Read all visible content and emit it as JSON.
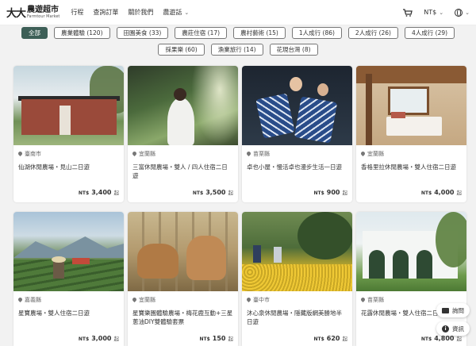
{
  "header": {
    "logo_zh": "農遊超市",
    "logo_en": "Farmtour Market",
    "nav": [
      {
        "label": "行程"
      },
      {
        "label": "查詢訂單"
      },
      {
        "label": "關於我們"
      },
      {
        "label": "農遊話"
      }
    ],
    "currency": "NT$"
  },
  "filters": {
    "row1": [
      "全部",
      "農業體驗 (120)",
      "田園美食 (33)",
      "農莊住宿 (17)",
      "農村藝術 (15)",
      "1人成行 (86)",
      "2人成行 (26)",
      "4人成行 (29)"
    ],
    "row2": [
      "採果樂 (60)",
      "漁業旅行 (14)",
      "花現台灣 (8)"
    ],
    "active": "全部"
  },
  "cards": [
    {
      "location": "臺南市",
      "title": "仙湖休閒農場・見山二日遊",
      "currency": "NT$",
      "price": "3,400",
      "suffix": "起"
    },
    {
      "location": "宜蘭縣",
      "title": "三富休閒農場・雙人 / 四人住宿二日遊",
      "currency": "NT$",
      "price": "3,500",
      "suffix": "起"
    },
    {
      "location": "苗栗縣",
      "title": "卓也小屋・慢活卓也漫步生活一日遊",
      "currency": "NT$",
      "price": "900",
      "suffix": "起"
    },
    {
      "location": "宜蘭縣",
      "title": "香格里拉休閒農場・雙人住宿二日遊",
      "currency": "NT$",
      "price": "4,000",
      "suffix": "起"
    },
    {
      "location": "嘉義縣",
      "title": "星寶農場・雙人住宿二日遊",
      "currency": "NT$",
      "price": "3,000",
      "suffix": "起"
    },
    {
      "location": "宜蘭縣",
      "title": "星寶樂園體驗農場・梅花鹿互動+三星蔥油DIY雙體驗套票",
      "currency": "NT$",
      "price": "150",
      "suffix": "起"
    },
    {
      "location": "臺中市",
      "title": "沐心泉休閒農場・隱藏版網美勝地半日遊",
      "currency": "NT$",
      "price": "620",
      "suffix": "起"
    },
    {
      "location": "苗栗縣",
      "title": "花露休閒農場・雙人住宿二日遊",
      "currency": "NT$",
      "price": "4,800",
      "suffix": "起"
    }
  ],
  "floating": {
    "chat_label": "詢問",
    "info_label": "資訊"
  }
}
